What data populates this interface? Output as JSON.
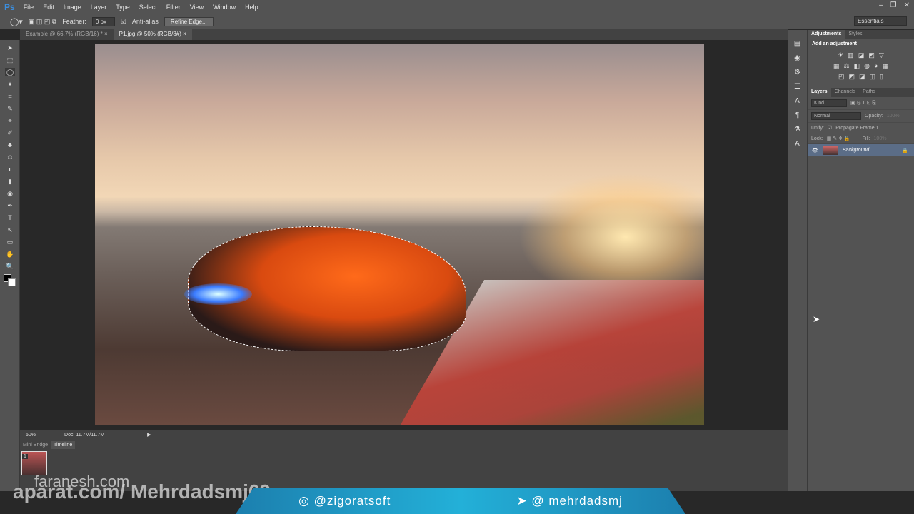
{
  "app": {
    "logo": "Ps"
  },
  "menu": [
    "File",
    "Edit",
    "Image",
    "Layer",
    "Type",
    "Select",
    "Filter",
    "View",
    "Window",
    "Help"
  ],
  "window_buttons": [
    "–",
    "❐",
    "✕"
  ],
  "options": {
    "feather_label": "Feather:",
    "feather_value": "0 px",
    "antialias_label": "Anti-alias",
    "refine_edge": "Refine Edge...",
    "workspace": "Essentials"
  },
  "tabs": [
    {
      "label": "Example @ 66.7% (RGB/16) *",
      "close": "×"
    },
    {
      "label": "P1.jpg @ 50% (RGB/8#)",
      "close": "×"
    }
  ],
  "tools": [
    "➤",
    "⬚",
    "◯",
    "✦",
    "⌗",
    "✎",
    "⌖",
    "✐",
    "♣",
    "⎌",
    "◐",
    "▮",
    "◉",
    "✒",
    "T",
    "↖",
    "▭",
    "✋",
    "🔍"
  ],
  "status": {
    "zoom": "50%",
    "doc": "Doc: 11.7M/11.7M"
  },
  "bottom": {
    "tabs": [
      "Mini Bridge",
      "Timeline"
    ],
    "frame_number": "1"
  },
  "panel": {
    "adj_tabs": [
      "Adjustments",
      "Styles"
    ],
    "adj_title": "Add an adjustment",
    "adj_icons": [
      [
        "☀",
        "▥",
        "◪",
        "◩",
        "▽"
      ],
      [
        "▦",
        "⚖",
        "◧",
        "◍",
        "◕",
        "▦"
      ],
      [
        "◰",
        "◩",
        "◪",
        "◫",
        "▯"
      ]
    ],
    "layer_tabs": [
      "Layers",
      "Channels",
      "Paths"
    ],
    "kind": "Kind",
    "blend": "Normal",
    "opacity_label": "Opacity:",
    "opacity": "100%",
    "unify_label": "Unify:",
    "propagate": "Propagate Frame 1",
    "lock_label": "Lock:",
    "fill_label": "Fill:",
    "fill": "100%",
    "layer_name": "Background"
  },
  "watermarks": {
    "faranesh": "faranesh.com",
    "aparat": "aparat.com/ Mehrdadsmj69",
    "instagram": "@zigoratsoft",
    "telegram": "@ mehrdadsmj"
  }
}
